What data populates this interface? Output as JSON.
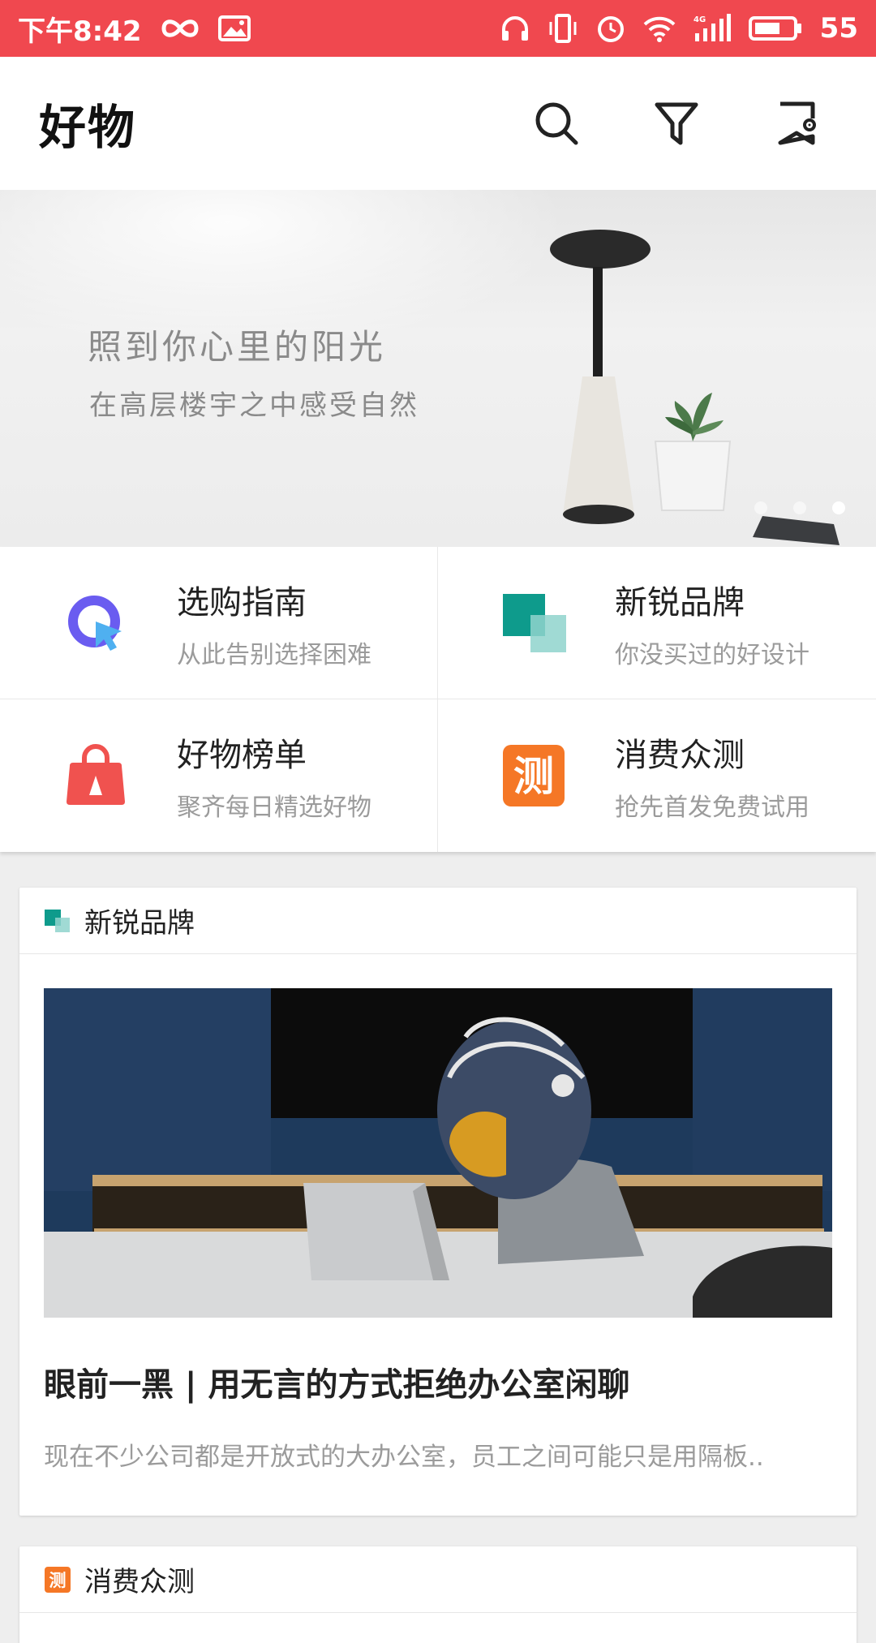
{
  "status_bar": {
    "time": "下午8:42",
    "battery": "55",
    "network": "4G"
  },
  "app_bar": {
    "title": "好物"
  },
  "banner": {
    "headline": "照到你心里的阳光",
    "subline": "在高层楼宇之中感受自然",
    "page_count": 3,
    "active_page": 3
  },
  "quick_links": [
    {
      "title": "选购指南",
      "subtitle": "从此告别选择困难",
      "icon": "guide-icon",
      "color": "#6a5cf0"
    },
    {
      "title": "新锐品牌",
      "subtitle": "你没买过的好设计",
      "icon": "brand-icon",
      "color": "#0e9b8c"
    },
    {
      "title": "好物榜单",
      "subtitle": "聚齐每日精选好物",
      "icon": "bag-icon",
      "color": "#f0524f"
    },
    {
      "title": "消费众测",
      "subtitle": "抢先首发免费试用",
      "icon": "test-icon",
      "color": "#f57726"
    }
  ],
  "sections": [
    {
      "label": "新锐品牌",
      "article": {
        "title": "眼前一黑 | 用无言的方式拒绝办公室闲聊",
        "summary": "现在不少公司都是开放式的大办公室，员工之间可能只是用隔板.."
      }
    },
    {
      "label": "消费众测"
    }
  ],
  "colors": {
    "status_bar": "#f0484f",
    "background": "#eeeeee"
  }
}
